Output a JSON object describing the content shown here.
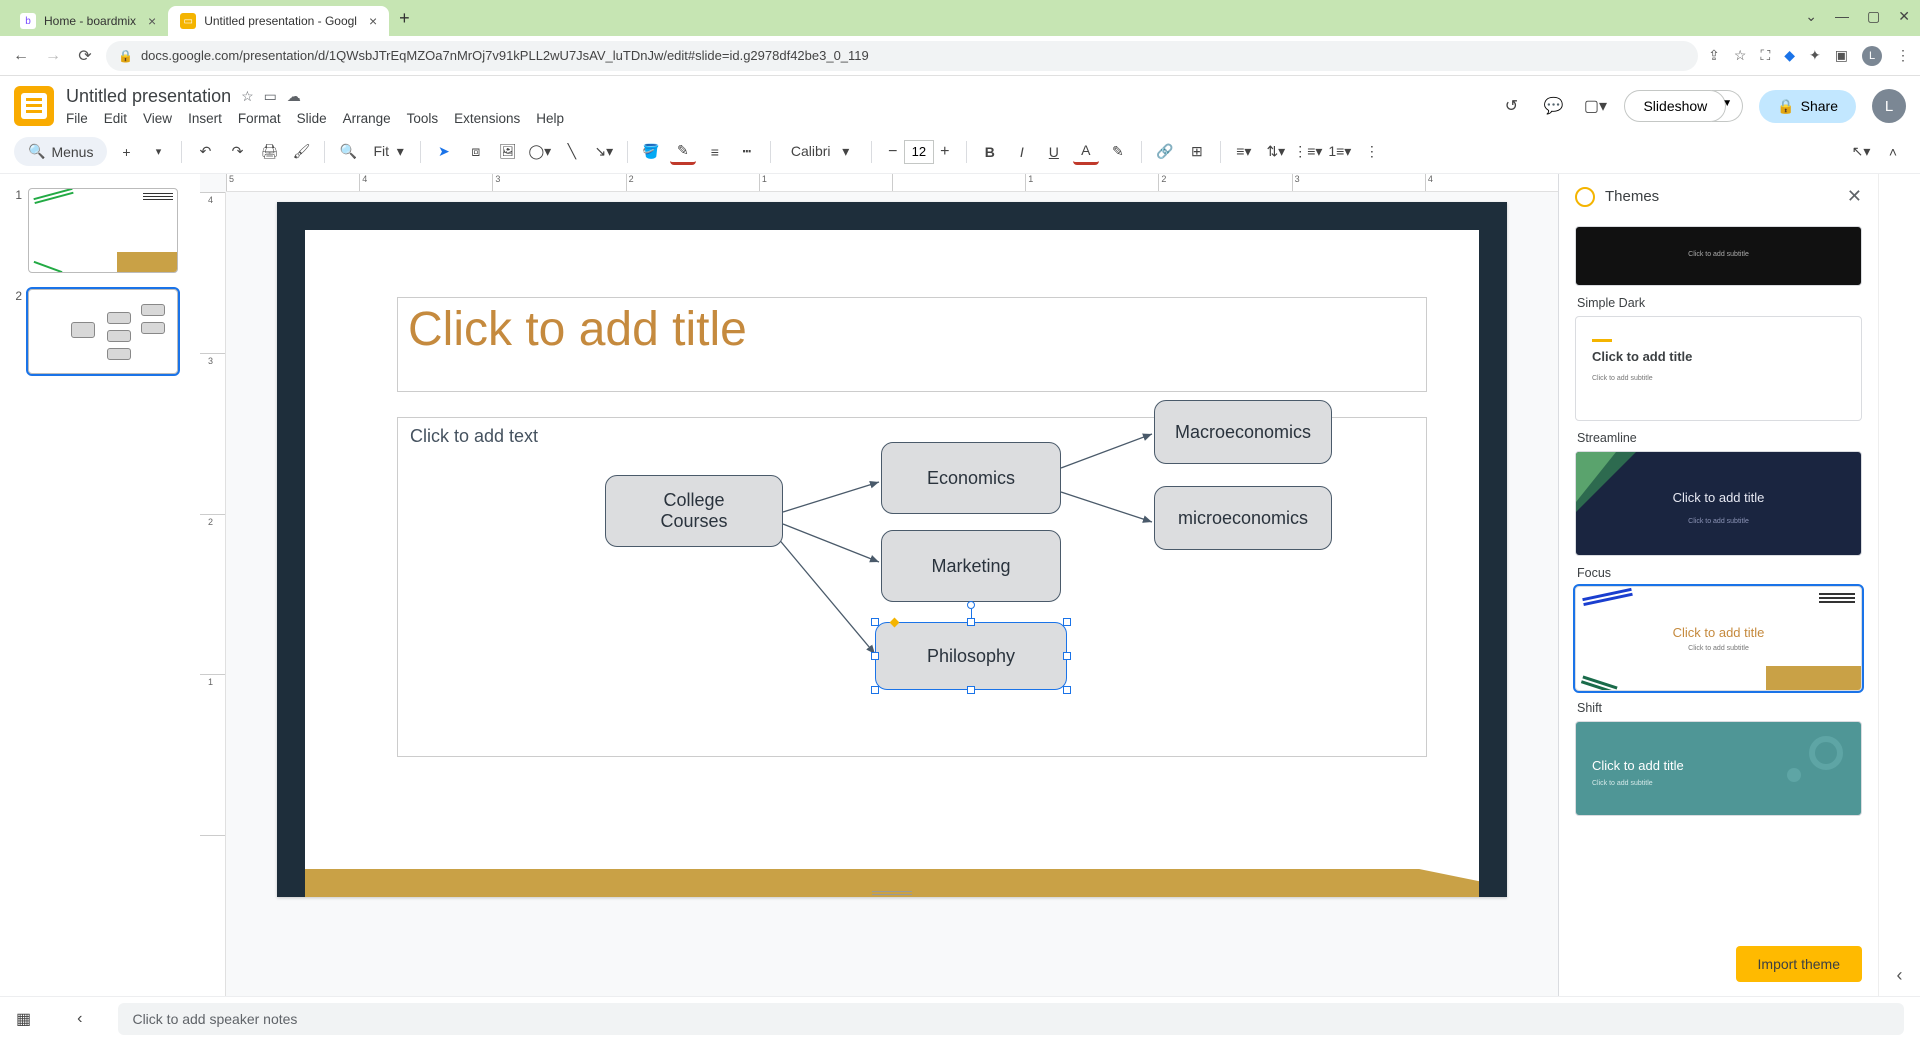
{
  "browser": {
    "tabs": [
      {
        "title": "Home - boardmix",
        "favColor": "#7a4cff"
      },
      {
        "title": "Untitled presentation - Googl",
        "favColor": "#f4b400"
      }
    ],
    "url": "docs.google.com/presentation/d/1QWsbJTrEqMZOa7nMrOj7v91kPLL2wU7JsAV_luTDnJw/edit#slide=id.g2978df42be3_0_119",
    "winMin": "—",
    "winMax": "▢",
    "winClose": "✕"
  },
  "doc": {
    "title": "Untitled presentation",
    "menus": [
      "File",
      "Edit",
      "View",
      "Insert",
      "Format",
      "Slide",
      "Arrange",
      "Tools",
      "Extensions",
      "Help"
    ]
  },
  "header": {
    "slideshow": "Slideshow",
    "share": "Share",
    "avatar": "L"
  },
  "toolbar": {
    "menus_label": "Menus",
    "fit": "Fit",
    "font": "Calibri",
    "fontsize": "12"
  },
  "slide": {
    "title_placeholder": "Click to add title",
    "text_placeholder": "Click to add text",
    "nodes": {
      "root": "College\nCourses",
      "econ": "Economics",
      "mkt": "Marketing",
      "phil": "Philosophy",
      "macro": "Macroeconomics",
      "micro": "microeconomics"
    }
  },
  "ruler_h": [
    "5",
    "4",
    "3",
    "2",
    "1",
    "",
    "1",
    "2",
    "3",
    "4"
  ],
  "ruler_v": [
    "4",
    "3",
    "2",
    "1",
    ""
  ],
  "themes": {
    "title": "Themes",
    "label_dark": "Simple Dark",
    "label_stream": "Streamline",
    "label_focus": "Focus",
    "label_shift": "Shift",
    "card_subtitle": "Click to add subtitle",
    "card_title": "Click to add title",
    "import": "Import theme"
  },
  "bottom": {
    "notes": "Click to add speaker notes"
  }
}
